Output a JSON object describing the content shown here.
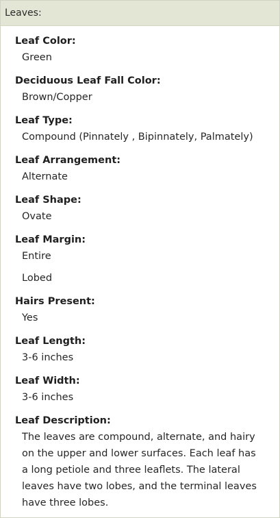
{
  "header": {
    "title": "Leaves:"
  },
  "fields": {
    "leaf_color": {
      "label": "Leaf Color:",
      "values": [
        "Green"
      ]
    },
    "fall_color": {
      "label": "Deciduous Leaf Fall Color:",
      "values": [
        "Brown/Copper"
      ]
    },
    "leaf_type": {
      "label": "Leaf Type:",
      "values": [
        "Compound (Pinnately , Bipinnately, Palmately)"
      ]
    },
    "arrangement": {
      "label": "Leaf Arrangement:",
      "values": [
        "Alternate"
      ]
    },
    "shape": {
      "label": "Leaf Shape:",
      "values": [
        "Ovate"
      ]
    },
    "margin": {
      "label": "Leaf Margin:",
      "values": [
        "Entire",
        "Lobed"
      ]
    },
    "hairs": {
      "label": "Hairs Present:",
      "values": [
        "Yes"
      ]
    },
    "length": {
      "label": "Leaf Length:",
      "values": [
        "3-6 inches"
      ]
    },
    "width": {
      "label": "Leaf Width:",
      "values": [
        "3-6 inches"
      ]
    },
    "description": {
      "label": "Leaf Description:",
      "text": "The leaves are compound, alternate, and hairy on the upper and lower surfaces. Each leaf has a long petiole and three leaflets. The lateral leaves have two lobes, and the terminal leaves have three lobes."
    }
  }
}
